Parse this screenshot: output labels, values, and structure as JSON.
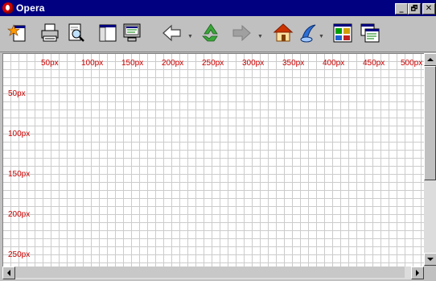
{
  "window": {
    "title": "Opera",
    "minimize_glyph": "_",
    "maximize_glyph": "🗗",
    "close_glyph": "✕"
  },
  "toolbar": {
    "items": [
      {
        "name": "hotlist-icon"
      },
      {
        "name": "print-icon"
      },
      {
        "name": "print-preview-icon"
      },
      {
        "name": "panel-icon"
      },
      {
        "name": "monitor-icon"
      },
      {
        "name": "back-icon"
      },
      {
        "name": "reload-icon"
      },
      {
        "name": "forward-icon"
      },
      {
        "name": "home-icon"
      },
      {
        "name": "search-icon"
      },
      {
        "name": "tile-icon"
      },
      {
        "name": "cascade-icon"
      }
    ]
  },
  "ruler": {
    "x_labels": [
      "50px",
      "100px",
      "150px",
      "200px",
      "250px",
      "300px",
      "350px",
      "400px",
      "450px",
      "500px"
    ],
    "y_labels": [
      "50px",
      "100px",
      "150px",
      "200px",
      "250px"
    ],
    "label_color": "#cc0000",
    "grid_color": "#cccccc"
  }
}
